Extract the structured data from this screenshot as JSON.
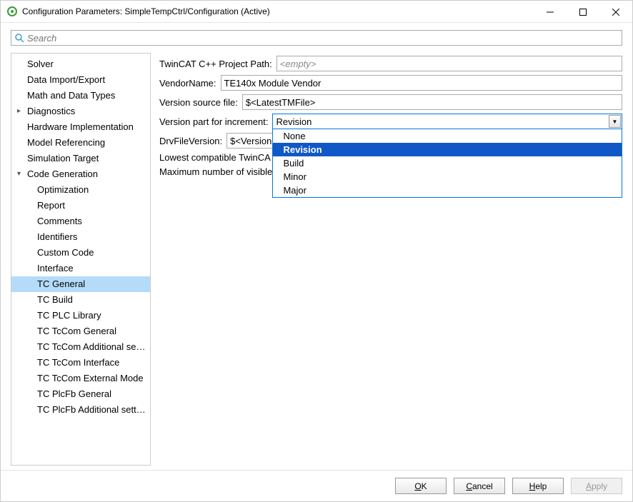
{
  "window": {
    "title": "Configuration Parameters: SimpleTempCtrl/Configuration (Active)"
  },
  "search": {
    "placeholder": "Search"
  },
  "sidebar": {
    "items": [
      {
        "label": "Solver",
        "level": 0
      },
      {
        "label": "Data Import/Export",
        "level": 0
      },
      {
        "label": "Math and Data Types",
        "level": 0
      },
      {
        "label": "Diagnostics",
        "level": 0,
        "parent": true
      },
      {
        "label": "Hardware Implementation",
        "level": 0
      },
      {
        "label": "Model Referencing",
        "level": 0
      },
      {
        "label": "Simulation Target",
        "level": 0
      },
      {
        "label": "Code Generation",
        "level": 0,
        "parent": true,
        "expanded": true
      },
      {
        "label": "Optimization",
        "level": 1
      },
      {
        "label": "Report",
        "level": 1
      },
      {
        "label": "Comments",
        "level": 1
      },
      {
        "label": "Identifiers",
        "level": 1
      },
      {
        "label": "Custom Code",
        "level": 1
      },
      {
        "label": "Interface",
        "level": 1
      },
      {
        "label": "TC General",
        "level": 1,
        "selected": true
      },
      {
        "label": "TC Build",
        "level": 1
      },
      {
        "label": "TC PLC Library",
        "level": 1
      },
      {
        "label": "TC TcCom General",
        "level": 1
      },
      {
        "label": "TC TcCom Additional setti...",
        "level": 1
      },
      {
        "label": "TC TcCom Interface",
        "level": 1
      },
      {
        "label": "TC TcCom External Mode",
        "level": 1
      },
      {
        "label": "TC PlcFb General",
        "level": 1
      },
      {
        "label": "TC PlcFb Additional settings",
        "level": 1
      }
    ]
  },
  "form": {
    "projectPath": {
      "label": "TwinCAT C++ Project Path:",
      "value": "",
      "placeholder": "<empty>"
    },
    "vendorName": {
      "label": "VendorName:",
      "value": "TE140x Module Vendor"
    },
    "versionSource": {
      "label": "Version source file:",
      "value": "$<LatestTMFile>"
    },
    "versionPart": {
      "label": "Version part for increment:",
      "value": "Revision",
      "options": [
        "None",
        "Revision",
        "Build",
        "Minor",
        "Major"
      ],
      "highlighted": "Revision"
    },
    "drvFileVersion": {
      "label": "DrvFileVersion:",
      "value": "$<Version"
    },
    "lowestCompat": {
      "label": "Lowest compatible TwinCA",
      "value": ""
    },
    "maxVisible": {
      "label": "Maximum number of visible",
      "value": ""
    }
  },
  "footer": {
    "ok": "OK",
    "cancel": "Cancel",
    "help": "Help",
    "apply": "Apply"
  }
}
